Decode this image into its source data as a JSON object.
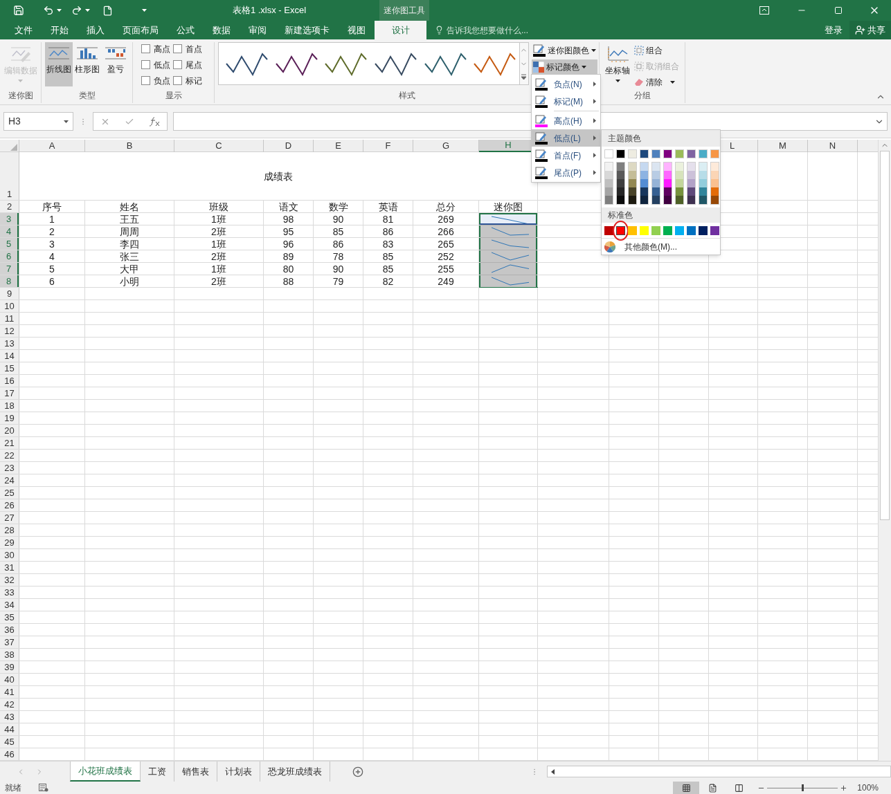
{
  "title_bar": {
    "title": "表格1 .xlsx - Excel",
    "context_tab": "迷你图工具"
  },
  "tabs": [
    {
      "label": "文件",
      "selected": false
    },
    {
      "label": "开始",
      "selected": false
    },
    {
      "label": "插入",
      "selected": false
    },
    {
      "label": "页面布局",
      "selected": false
    },
    {
      "label": "公式",
      "selected": false
    },
    {
      "label": "数据",
      "selected": false
    },
    {
      "label": "审阅",
      "selected": false
    },
    {
      "label": "新建选项卡",
      "selected": false
    },
    {
      "label": "视图",
      "selected": false
    },
    {
      "label": "设计",
      "selected": true
    }
  ],
  "tell_me": {
    "placeholder": "告诉我您想要做什么..."
  },
  "account": {
    "sign_in": "登录",
    "share": "共享"
  },
  "ribbon": {
    "sparkline_group": {
      "label": "迷你图",
      "edit_data": {
        "label": "编辑数据",
        "disabled": true
      }
    },
    "type_group": {
      "label": "类型",
      "types": [
        {
          "label": "折线图",
          "kind": "line",
          "selected": true
        },
        {
          "label": "柱形图",
          "kind": "column",
          "selected": false
        },
        {
          "label": "盈亏",
          "kind": "winloss",
          "selected": false
        }
      ]
    },
    "show_group": {
      "label": "显示",
      "options": [
        {
          "label": "高点",
          "checked": false
        },
        {
          "label": "首点",
          "checked": false
        },
        {
          "label": "低点",
          "checked": false
        },
        {
          "label": "尾点",
          "checked": false
        },
        {
          "label": "负点",
          "checked": false
        },
        {
          "label": "标记",
          "checked": false
        }
      ]
    },
    "style_group": {
      "label": "样式",
      "styles": [
        {
          "color": "#2f4b6e"
        },
        {
          "color": "#5a1f57"
        },
        {
          "color": "#5e6b2a"
        },
        {
          "color": "#374a60"
        },
        {
          "color": "#2d5f6c"
        },
        {
          "color": "#c55a11"
        }
      ],
      "sparkline_color": {
        "label": "迷你图颜色",
        "pressed": false
      },
      "marker_color": {
        "label": "标记颜色",
        "pressed": true
      }
    },
    "group_group": {
      "label": "分组",
      "axis": {
        "label": "坐标轴"
      },
      "group": {
        "label": "组合",
        "disabled": false
      },
      "ungroup": {
        "label": "取消组合",
        "disabled": true
      },
      "clear": {
        "label": "清除",
        "disabled": false
      }
    }
  },
  "formula_bar": {
    "name_box": "H3"
  },
  "sheet": {
    "columns": [
      {
        "label": "A",
        "selected": false
      },
      {
        "label": "B",
        "selected": false
      },
      {
        "label": "C",
        "selected": false
      },
      {
        "label": "D",
        "selected": false
      },
      {
        "label": "E",
        "selected": false
      },
      {
        "label": "F",
        "selected": false
      },
      {
        "label": "G",
        "selected": false
      },
      {
        "label": "H",
        "selected": true
      },
      {
        "label": "L",
        "selected": false
      },
      {
        "label": "M",
        "selected": false
      },
      {
        "label": "N",
        "selected": false
      }
    ],
    "title_row": "1",
    "title": "成绩表",
    "header_row": "2",
    "headers": [
      "序号",
      "姓名",
      "班级",
      "语文",
      "数学",
      "英语",
      "总分",
      "迷你图"
    ],
    "rows": [
      {
        "number": "3",
        "selected": true,
        "active": true,
        "cells": [
          "1",
          "王五",
          "1班",
          "98",
          "90",
          "81",
          "269"
        ]
      },
      {
        "number": "4",
        "selected": true,
        "active": false,
        "cells": [
          "2",
          "周周",
          "2班",
          "95",
          "85",
          "86",
          "266"
        ]
      },
      {
        "number": "5",
        "selected": true,
        "active": false,
        "cells": [
          "3",
          "李四",
          "1班",
          "96",
          "86",
          "83",
          "265"
        ]
      },
      {
        "number": "6",
        "selected": true,
        "active": false,
        "cells": [
          "4",
          "张三",
          "2班",
          "89",
          "78",
          "85",
          "252"
        ]
      },
      {
        "number": "7",
        "selected": true,
        "active": false,
        "cells": [
          "5",
          "大甲",
          "1班",
          "80",
          "90",
          "85",
          "255"
        ]
      },
      {
        "number": "8",
        "selected": true,
        "active": false,
        "cells": [
          "6",
          "小明",
          "2班",
          "88",
          "79",
          "82",
          "249"
        ]
      }
    ],
    "empty_rows": [
      "9",
      "10",
      "11",
      "12",
      "13",
      "14",
      "15",
      "16",
      "17",
      "18",
      "19",
      "20",
      "21",
      "22",
      "23",
      "24",
      "25",
      "26",
      "27",
      "28",
      "29",
      "30",
      "31",
      "32",
      "33",
      "34",
      "35",
      "36",
      "37",
      "38",
      "39",
      "40",
      "41",
      "42",
      "43",
      "44",
      "45",
      "46"
    ]
  },
  "marker_menu": [
    {
      "label": "负点(N)",
      "color": "#000000",
      "selected": false,
      "separator_before": false
    },
    {
      "label": "标记(M)",
      "color": "#000000",
      "selected": false,
      "separator_before": false
    },
    {
      "label": "高点(H)",
      "color": "#ff00ff",
      "selected": false,
      "separator_before": true
    },
    {
      "label": "低点(L)",
      "color": "#000000",
      "selected": true,
      "separator_before": false
    },
    {
      "label": "首点(F)",
      "color": "#000000",
      "selected": false,
      "separator_before": false
    },
    {
      "label": "尾点(P)",
      "color": "#000000",
      "selected": false,
      "separator_before": false
    }
  ],
  "palette": {
    "theme_heading": "主题颜色",
    "theme_colors": [
      {
        "color": "#ffffff"
      },
      {
        "color": "#000000"
      },
      {
        "color": "#eeece1"
      },
      {
        "color": "#1f497d"
      },
      {
        "color": "#4f81bd"
      },
      {
        "color": "#800080"
      },
      {
        "color": "#9bbb59"
      },
      {
        "color": "#8064a2"
      },
      {
        "color": "#4bacc6"
      },
      {
        "color": "#f79646"
      }
    ],
    "shade_columns": [
      [
        {
          "color": "#f2f2f2"
        },
        {
          "color": "#d8d8d8"
        },
        {
          "color": "#bfbfbf"
        },
        {
          "color": "#a5a5a5"
        },
        {
          "color": "#7f7f7f"
        }
      ],
      [
        {
          "color": "#7f7f7f"
        },
        {
          "color": "#595959"
        },
        {
          "color": "#3f3f3f"
        },
        {
          "color": "#262626"
        },
        {
          "color": "#0c0c0c"
        }
      ],
      [
        {
          "color": "#ddd9c3"
        },
        {
          "color": "#c4bd97"
        },
        {
          "color": "#938953"
        },
        {
          "color": "#494429"
        },
        {
          "color": "#1d1b10"
        }
      ],
      [
        {
          "color": "#c6d9f0"
        },
        {
          "color": "#8db3e2"
        },
        {
          "color": "#548dd4"
        },
        {
          "color": "#17365d"
        },
        {
          "color": "#0f243e"
        }
      ],
      [
        {
          "color": "#dbe5f1"
        },
        {
          "color": "#b8cce4"
        },
        {
          "color": "#95b3d7"
        },
        {
          "color": "#366092"
        },
        {
          "color": "#244061"
        }
      ],
      [
        {
          "color": "#ffb3ff"
        },
        {
          "color": "#ff66ff"
        },
        {
          "color": "#ff1aff"
        },
        {
          "color": "#600060"
        },
        {
          "color": "#400040"
        }
      ],
      [
        {
          "color": "#ebf1dd"
        },
        {
          "color": "#d7e3bc"
        },
        {
          "color": "#c3d69b"
        },
        {
          "color": "#76923c"
        },
        {
          "color": "#4f6128"
        }
      ],
      [
        {
          "color": "#e5e0ec"
        },
        {
          "color": "#ccc1d9"
        },
        {
          "color": "#b2a2c7"
        },
        {
          "color": "#5f497a"
        },
        {
          "color": "#3f3151"
        }
      ],
      [
        {
          "color": "#dbeef3"
        },
        {
          "color": "#b7dde8"
        },
        {
          "color": "#92cddc"
        },
        {
          "color": "#31859b"
        },
        {
          "color": "#205867"
        }
      ],
      [
        {
          "color": "#fdeada"
        },
        {
          "color": "#fbd5b5"
        },
        {
          "color": "#fac08f"
        },
        {
          "color": "#e36c09"
        },
        {
          "color": "#974806"
        }
      ]
    ],
    "standard_heading": "标准色",
    "standard_colors": [
      {
        "color": "#c00000",
        "selected": false
      },
      {
        "color": "#ff0000",
        "selected": true
      },
      {
        "color": "#ffc000",
        "selected": false
      },
      {
        "color": "#ffff00",
        "selected": false
      },
      {
        "color": "#92d050",
        "selected": false
      },
      {
        "color": "#00b050",
        "selected": false
      },
      {
        "color": "#00b0f0",
        "selected": false
      },
      {
        "color": "#0070c0",
        "selected": false
      },
      {
        "color": "#002060",
        "selected": false
      },
      {
        "color": "#7030a0",
        "selected": false
      }
    ],
    "more_colors": "其他颜色(M)..."
  },
  "sheet_tabs": [
    {
      "label": "小花班成绩表",
      "selected": true
    },
    {
      "label": "工资",
      "selected": false
    },
    {
      "label": "销售表",
      "selected": false
    },
    {
      "label": "计划表",
      "selected": false
    },
    {
      "label": "恐龙班成绩表",
      "selected": false
    }
  ],
  "status_bar": {
    "ready": "就绪",
    "views": [
      {
        "kind": "normal",
        "selected": true
      },
      {
        "kind": "page_layout",
        "selected": false
      },
      {
        "kind": "page_break",
        "selected": false
      }
    ],
    "zoom": {
      "level": 0.5,
      "reading": "100%"
    }
  }
}
